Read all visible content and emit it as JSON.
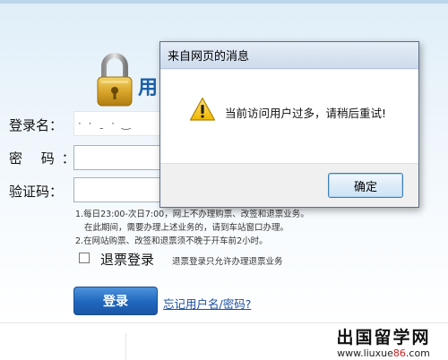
{
  "login": {
    "title": "用",
    "username_label": "登录名：",
    "username_value": "· · ˍ ·  ‿",
    "password_label": "密 码：",
    "captcha_label": "验证码：",
    "notes": [
      "1.每日23:00-次日7:00，网上不办理购票、改签和退票业务。",
      "在此期间，需要办理上述业务的，请到车站窗口办理。",
      "2.在网站购票、改签和退票须不晚于开车前2小时。"
    ],
    "refund_label": "退票登录",
    "refund_note": "退票登录只允许办理退票业务",
    "login_button": "登录",
    "forgot_link": "忘记用户名/密码?"
  },
  "dialog": {
    "title": "来自网页的消息",
    "message": "当前访问用户过多，请稍后重试!",
    "ok_button": "确定"
  },
  "watermark": {
    "title": "出国留学网",
    "url_prefix": "www.liuxue",
    "url_accent": "86",
    "url_suffix": ".com"
  },
  "colors": {
    "accent_blue": "#1f66bd",
    "warning_yellow": "#f4c20d",
    "watermark_red": "#d21c1c"
  },
  "icons": {
    "lock": "padlock-icon",
    "warning": "warning-triangle-icon"
  }
}
